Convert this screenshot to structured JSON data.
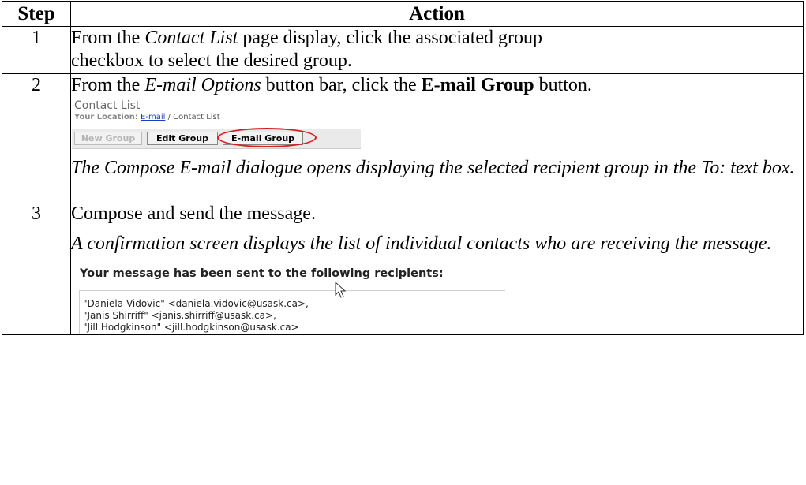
{
  "table": {
    "headers": {
      "step": "Step",
      "action": "Action"
    },
    "rows": [
      {
        "num": "1",
        "line1_pre": "From the ",
        "line1_italic": "Contact List",
        "line1_post": " page display, click the associated group",
        "line2": "checkbox to select the desired group."
      },
      {
        "num": "2",
        "pre": "From the ",
        "italic": "E-mail Options",
        "mid": " button bar, click the ",
        "bold": "E-mail Group",
        "post": " button.",
        "note": "The Compose E-mail dialogue opens displaying the selected recipient group in the To: text box."
      },
      {
        "num": "3",
        "text": "Compose and send the message.",
        "note": "A confirmation screen displays the list of individual contacts who are receiving the message."
      }
    ]
  },
  "contact_ui": {
    "title": "Contact List",
    "location_label": "Your Location:",
    "location_link": "E-mail",
    "location_rest": " / Contact List",
    "buttons": {
      "new_group": "New Group",
      "edit_group": "Edit Group",
      "email_group": "E-mail Group"
    },
    "highlight_color": "#d42020"
  },
  "confirmation_ui": {
    "heading": "Your message has been sent to the following recipients:",
    "recipients": [
      "\"Daniela Vidovic\" <daniela.vidovic@usask.ca>,",
      "\"Janis Shirriff\" <janis.shirriff@usask.ca>,",
      "\"Jill Hodgkinson\" <jill.hodgkinson@usask.ca>"
    ]
  }
}
